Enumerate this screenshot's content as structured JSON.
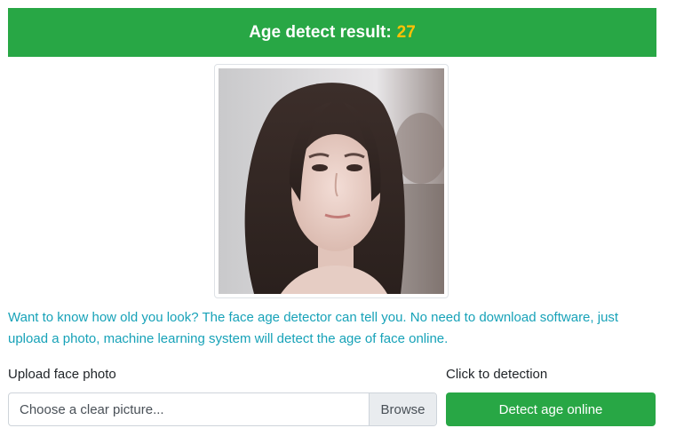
{
  "result": {
    "label": "Age detect result:",
    "age": "27",
    "label_color": "#ffffff",
    "age_color": "#ffc107",
    "background": "#28a745"
  },
  "photo": {
    "alt": "face photo"
  },
  "intro": {
    "text": "Want to know how old you look? The face age detector can tell you. No need to download software, just upload a photo, machine learning system will detect the age of face online.",
    "color": "#17a2b8"
  },
  "upload": {
    "label": "Upload face photo",
    "placeholder": "Choose a clear picture...",
    "browse_label": "Browse"
  },
  "detect": {
    "label": "Click to detection",
    "button_label": "Detect age online",
    "button_color": "#28a745"
  }
}
